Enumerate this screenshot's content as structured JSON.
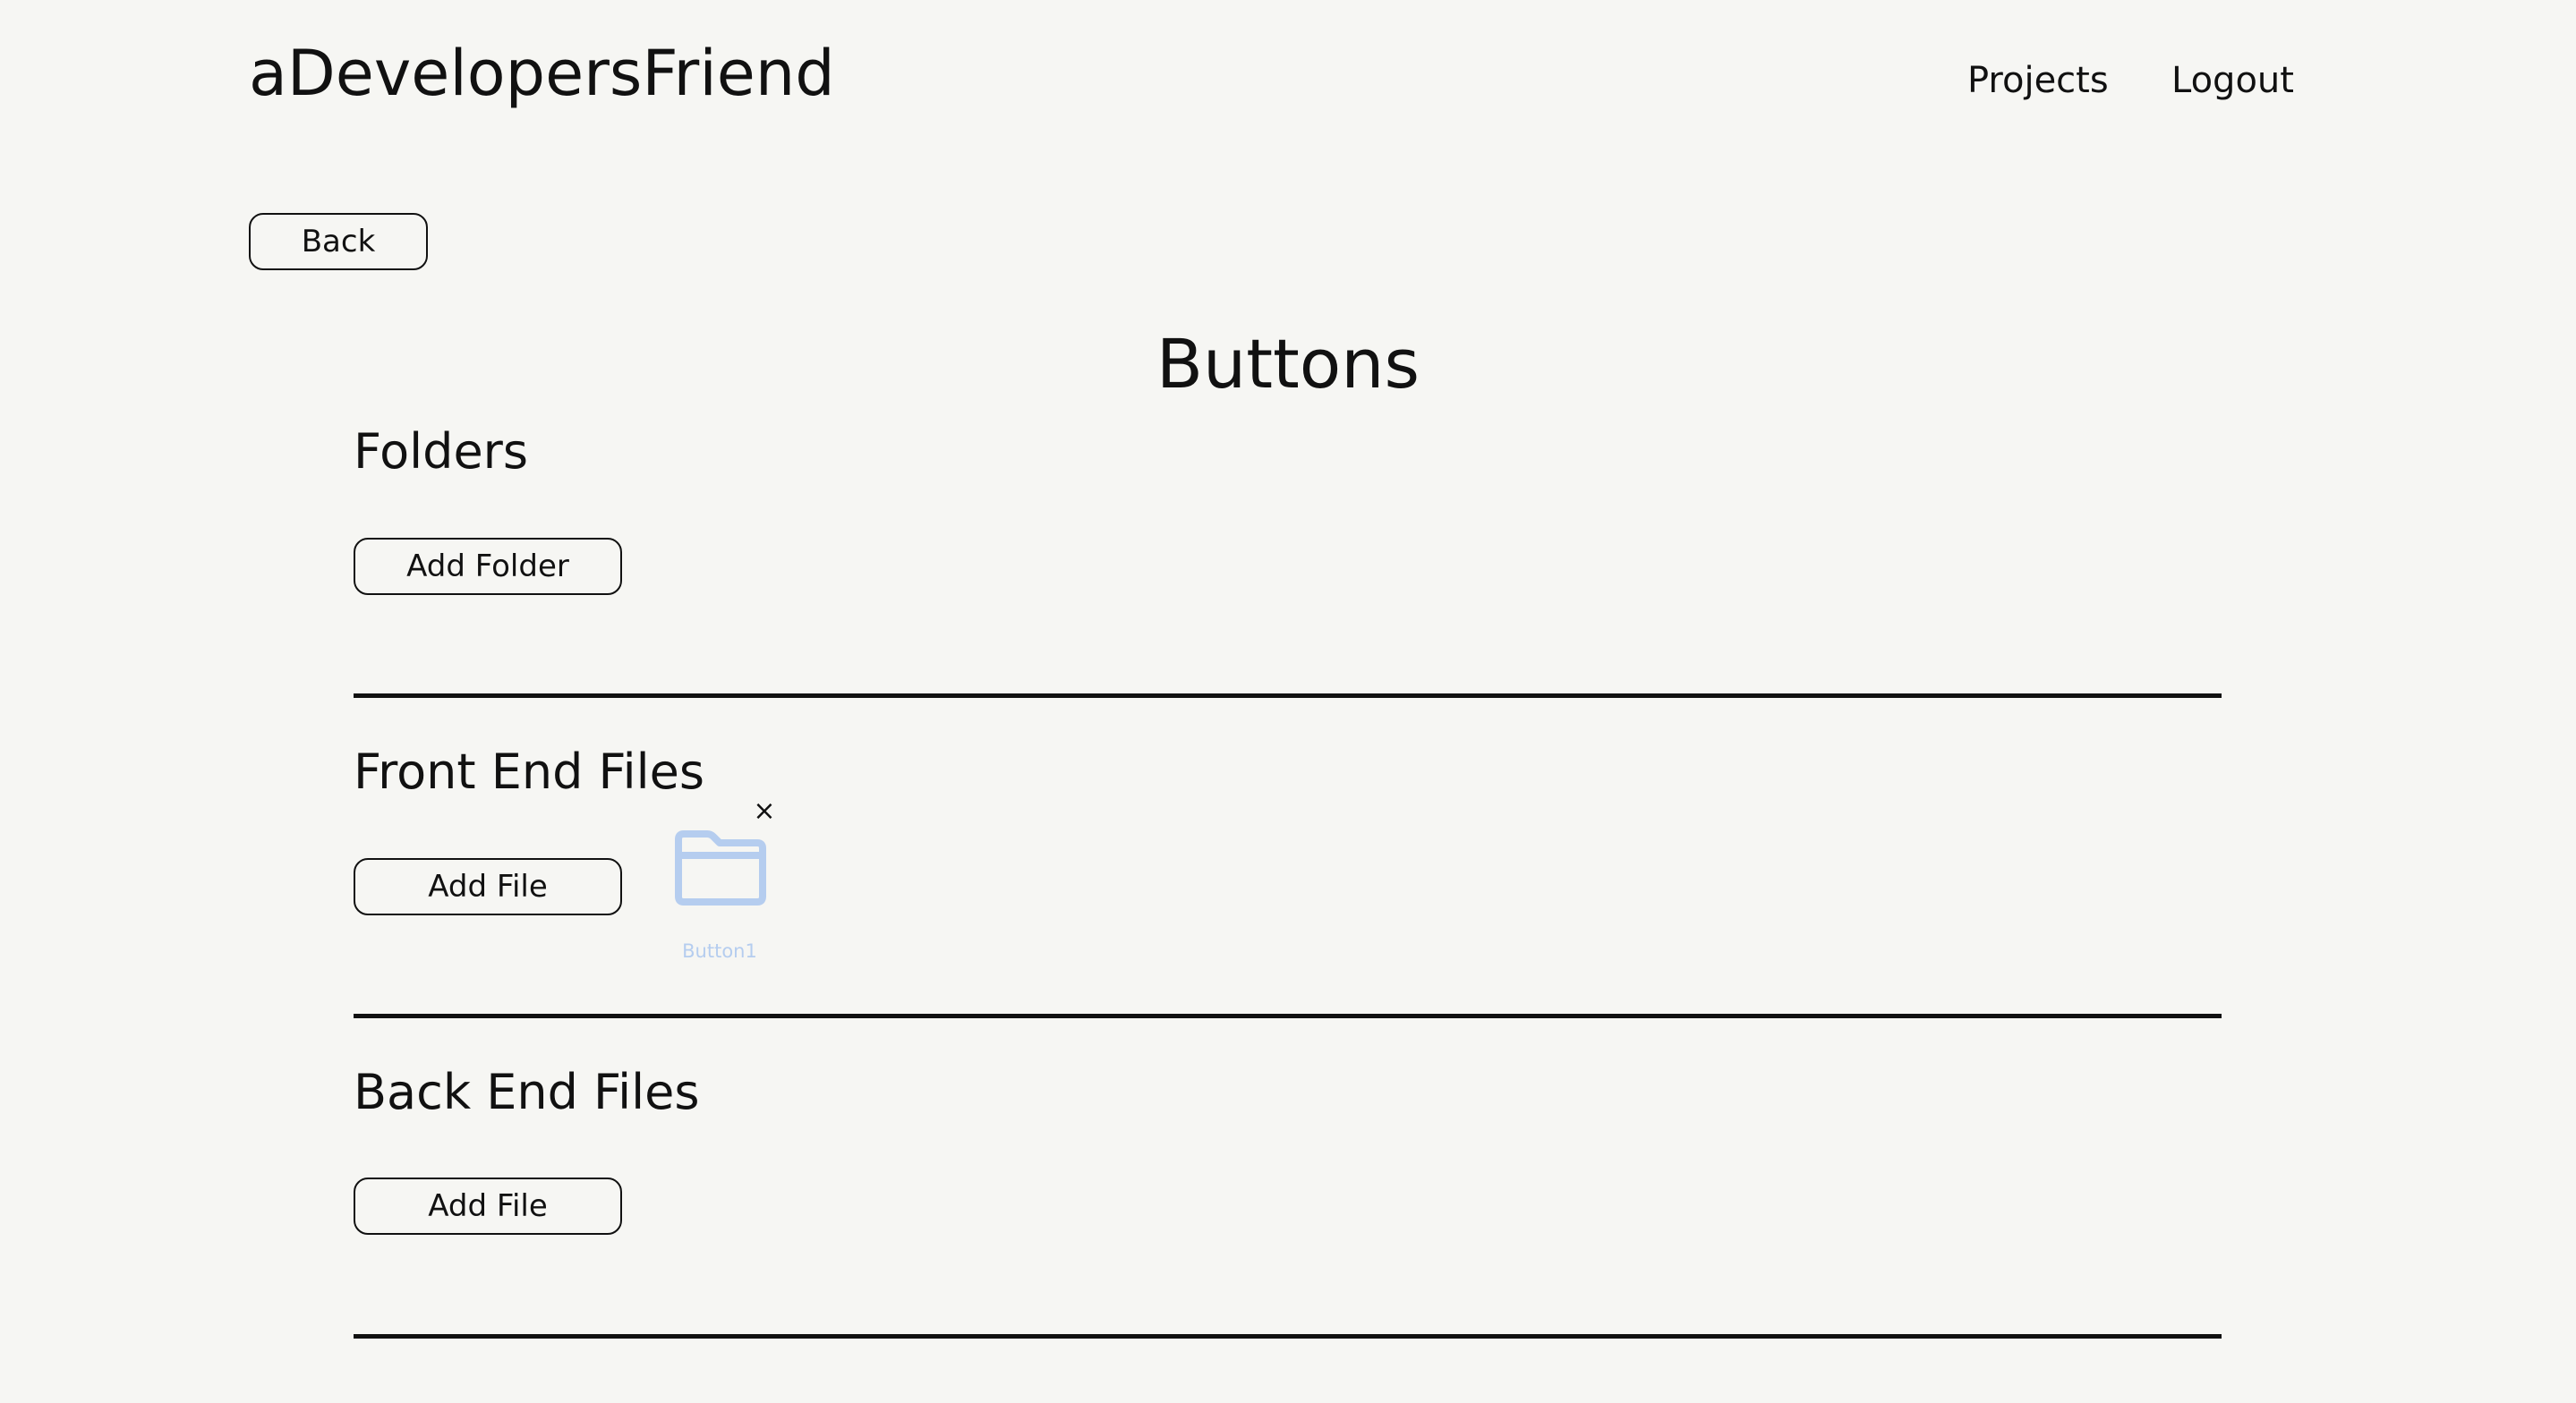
{
  "header": {
    "brand": "aDevelopersFriend",
    "nav": {
      "projects": "Projects",
      "logout": "Logout"
    }
  },
  "back_label": "Back",
  "page_title": "Buttons",
  "sections": [
    {
      "title": "Folders",
      "add_label": "Add Folder"
    },
    {
      "title": "Front End Files",
      "add_label": "Add File",
      "files": [
        {
          "name": "Button1",
          "icon": "folder-icon",
          "close_icon": "close-icon",
          "close_glyph": "×"
        }
      ]
    },
    {
      "title": "Back End Files",
      "add_label": "Add File"
    }
  ],
  "colors": {
    "background": "#f6f6f3",
    "text": "#111111",
    "file_icon": "#b5cdef"
  }
}
